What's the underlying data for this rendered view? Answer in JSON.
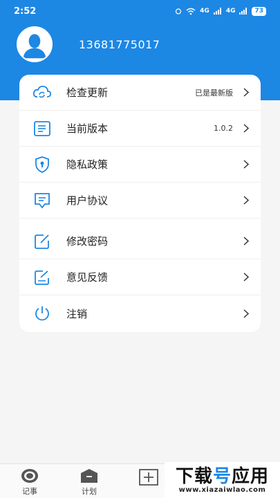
{
  "status_bar": {
    "time": "2:52",
    "network_1": "4G",
    "network_2": "4G",
    "battery": "73"
  },
  "profile": {
    "phone": "13681775017"
  },
  "menu": {
    "items": [
      {
        "label": "检查更新",
        "value": "已是最新版",
        "icon": "cloud-refresh-icon"
      },
      {
        "label": "当前版本",
        "value": "1.0.2",
        "icon": "document-lines-icon"
      },
      {
        "label": "隐私政策",
        "value": "",
        "icon": "shield-lock-icon"
      },
      {
        "label": "用户协议",
        "value": "",
        "icon": "agreement-icon"
      },
      {
        "label": "修改密码",
        "value": "",
        "icon": "edit-icon"
      },
      {
        "label": "意见反馈",
        "value": "",
        "icon": "feedback-icon"
      },
      {
        "label": "注销",
        "value": "",
        "icon": "power-icon"
      }
    ]
  },
  "tabbar": {
    "tabs": [
      {
        "label": "记事",
        "icon": "notes-icon"
      },
      {
        "label": "计划",
        "icon": "plan-icon"
      },
      {
        "label": "",
        "icon": "add-icon"
      }
    ]
  },
  "watermark": {
    "title_part1": "下载",
    "title_part2": "号",
    "title_part3": "应用",
    "url": "www.xiazaiwlao.com"
  },
  "colors": {
    "primary": "#1d87e4",
    "background": "#f5f5f5",
    "card": "#ffffff"
  }
}
